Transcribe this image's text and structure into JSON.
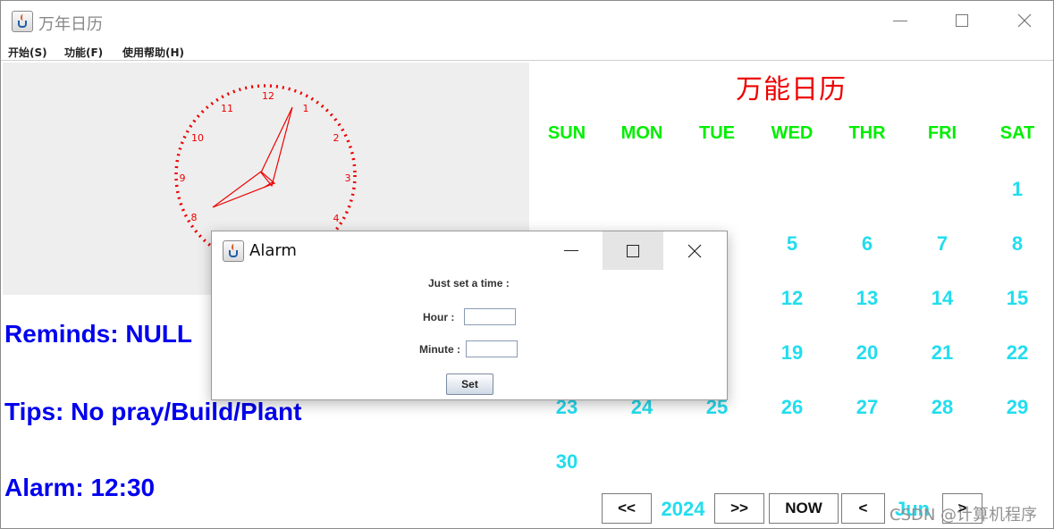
{
  "main_window": {
    "title": "万年日历",
    "menu": [
      "开始(S)",
      "功能(F)",
      "使用帮助(H)"
    ]
  },
  "clock": {
    "numbers": [
      "12",
      "1",
      "2",
      "3",
      "4",
      "8",
      "9",
      "10",
      "11"
    ],
    "color": "#ee0000",
    "panel_color": "#eeeeee"
  },
  "info": {
    "reminds": "Reminds: NULL",
    "tips": "Tips: No pray/Build/Plant",
    "alarm": "Alarm: 12:30"
  },
  "calendar": {
    "title": "万能日历",
    "weekdays": [
      "SUN",
      "MON",
      "TUE",
      "WED",
      "THR",
      "FRI",
      "SAT"
    ],
    "days_row1": [
      "1"
    ],
    "days_row2": [
      "5",
      "6",
      "7",
      "8"
    ],
    "days_row3": [
      "12",
      "13",
      "14",
      "15"
    ],
    "days_row4": [
      "19",
      "20",
      "21",
      "22"
    ],
    "days_row5": [
      "23",
      "24",
      "25",
      "26",
      "27",
      "28",
      "29"
    ],
    "days_row6": [
      "30"
    ],
    "title_color": "#ee0000",
    "weekday_color": "#00ee00",
    "day_color": "#22ddee"
  },
  "navigation": {
    "prev_year": "<<",
    "year": "2024",
    "next_year": ">>",
    "now": "NOW",
    "prev_month": "<",
    "month": "Jun",
    "next_month": ">"
  },
  "watermark": "CSDN @计算机程序",
  "alarm_dialog": {
    "title": "Alarm",
    "prompt": "Just set a time :",
    "hour_label": "Hour  :",
    "minute_label": "Minute :",
    "hour_value": "",
    "minute_value": "",
    "set_label": "Set"
  }
}
